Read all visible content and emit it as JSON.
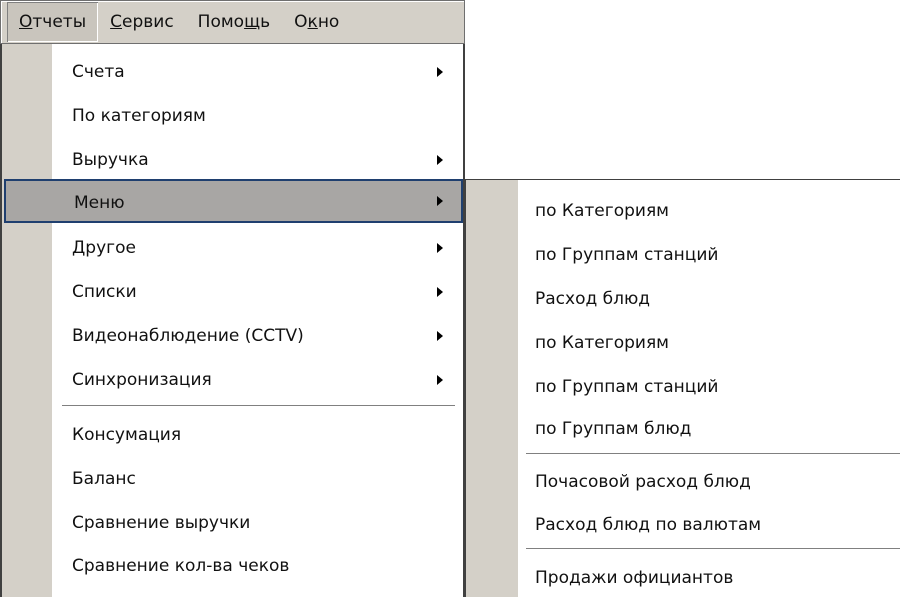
{
  "menubar": {
    "items": [
      {
        "pre": "",
        "ul": "О",
        "post": "тчеты",
        "open": true
      },
      {
        "pre": "",
        "ul": "С",
        "post": "ервис",
        "open": false
      },
      {
        "pre": "Помо",
        "ul": "щ",
        "post": "ь",
        "open": false
      },
      {
        "pre": "О",
        "ul": "к",
        "post": "но",
        "open": false
      }
    ]
  },
  "main_menu": {
    "items": [
      {
        "label": "Счета",
        "has_submenu": true
      },
      {
        "label": "По категориям",
        "has_submenu": false
      },
      {
        "label": "Выручка",
        "has_submenu": true
      },
      {
        "label": "Меню",
        "has_submenu": true,
        "selected": true
      },
      {
        "label": "Другое",
        "has_submenu": true
      },
      {
        "label": "Списки",
        "has_submenu": true
      },
      {
        "label": "Видеонаблюдение (CCTV)",
        "has_submenu": true
      },
      {
        "label": "Синхронизация",
        "has_submenu": true
      },
      {
        "label": "Консумация",
        "has_submenu": false
      },
      {
        "label": "Баланс",
        "has_submenu": false
      },
      {
        "label": "Сравнение выручки",
        "has_submenu": false
      },
      {
        "label": "Сравнение кол-ва чеков",
        "has_submenu": false
      }
    ]
  },
  "sub_menu": {
    "items": [
      {
        "label": "по Категориям"
      },
      {
        "label": "по Группам станций"
      },
      {
        "label": "Расход блюд"
      },
      {
        "label": "по Категориям"
      },
      {
        "label": "по Группам станций"
      },
      {
        "label": "по Группам блюд"
      },
      {
        "label": "Почасовой расход блюд"
      },
      {
        "label": "Расход блюд по валютам"
      },
      {
        "label": "Продажи официантов"
      }
    ]
  },
  "colors": {
    "menu_face": "#d4d0c8",
    "selected_bg": "#a8a6a4",
    "selected_border": "#1f3f6f"
  }
}
